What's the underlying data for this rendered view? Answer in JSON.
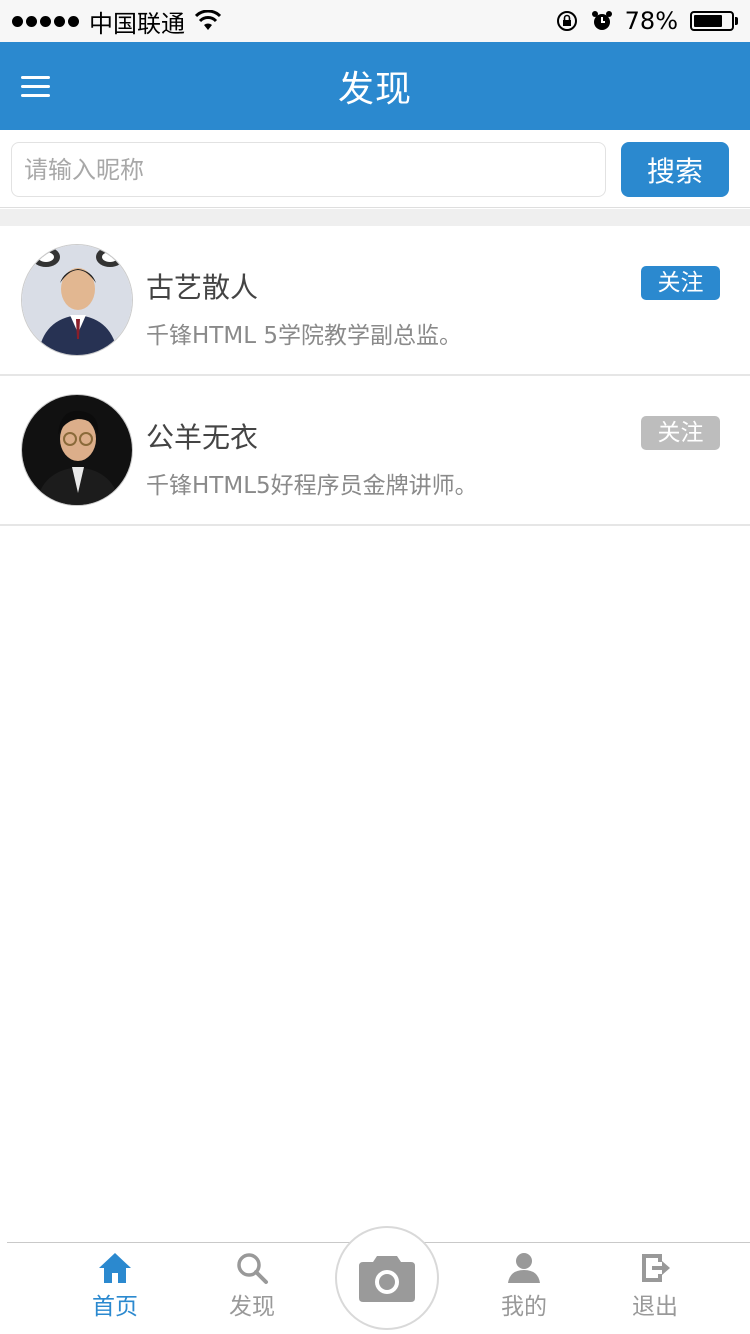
{
  "status_bar": {
    "carrier": "中国联通",
    "battery": "78%",
    "battery_level": 0.78
  },
  "header": {
    "title": "发现"
  },
  "search": {
    "placeholder": "请输入昵称",
    "value": "",
    "button_label": "搜索"
  },
  "users": [
    {
      "name": "古艺散人",
      "desc": "千锋HTML 5学院教学副总监。",
      "follow_label": "关注",
      "follow_color": "#2b89cf"
    },
    {
      "name": "公羊无衣",
      "desc": "千锋HTML5好程序员金牌讲师。",
      "follow_label": "关注",
      "follow_color": "#bdbdbd"
    }
  ],
  "tabs": [
    {
      "label": "首页",
      "icon": "home-icon",
      "active": true
    },
    {
      "label": "发现",
      "icon": "search-icon",
      "active": false
    },
    {
      "label": "",
      "icon": "camera-icon",
      "active": false
    },
    {
      "label": "我的",
      "icon": "user-icon",
      "active": false
    },
    {
      "label": "退出",
      "icon": "logout-icon",
      "active": false
    }
  ],
  "colors": {
    "primary": "#2b89cf",
    "inactive": "#999999",
    "tab_active": "#2b89cf"
  }
}
